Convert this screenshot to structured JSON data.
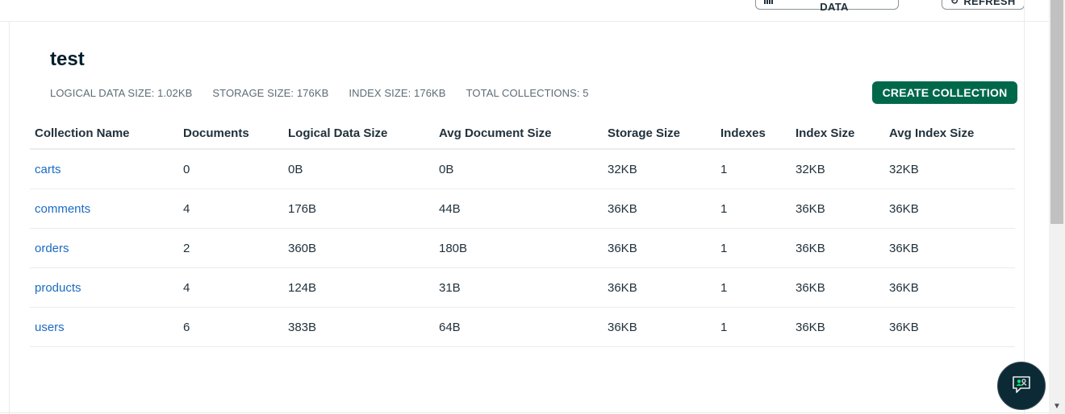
{
  "toolbar": {
    "visualize_label": "VISUALIZE YOUR DATA",
    "visualize_icon": "bar-chart-icon",
    "refresh_label": "REFRESH",
    "refresh_icon": "refresh-icon"
  },
  "database": {
    "name": "test",
    "stats": [
      "LOGICAL DATA SIZE: 1.02KB",
      "STORAGE SIZE: 176KB",
      "INDEX SIZE: 176KB",
      "TOTAL COLLECTIONS: 5"
    ],
    "create_label": "CREATE COLLECTION"
  },
  "table": {
    "columns": [
      "Collection Name",
      "Documents",
      "Logical Data Size",
      "Avg Document Size",
      "Storage Size",
      "Indexes",
      "Index Size",
      "Avg Index Size"
    ],
    "rows": [
      [
        "carts",
        "0",
        "0B",
        "0B",
        "32KB",
        "1",
        "32KB",
        "32KB"
      ],
      [
        "comments",
        "4",
        "176B",
        "44B",
        "36KB",
        "1",
        "36KB",
        "36KB"
      ],
      [
        "orders",
        "2",
        "360B",
        "180B",
        "36KB",
        "1",
        "36KB",
        "36KB"
      ],
      [
        "products",
        "4",
        "124B",
        "31B",
        "36KB",
        "1",
        "36KB",
        "36KB"
      ],
      [
        "users",
        "6",
        "383B",
        "64B",
        "36KB",
        "1",
        "36KB",
        "36KB"
      ]
    ]
  },
  "chat": {
    "icon": "chat-assistant-icon"
  },
  "colors": {
    "primary_button": "#00684a",
    "link": "#1a6bc4",
    "chat_bg": "#0b2a36",
    "chat_accent": "#00ed64"
  }
}
